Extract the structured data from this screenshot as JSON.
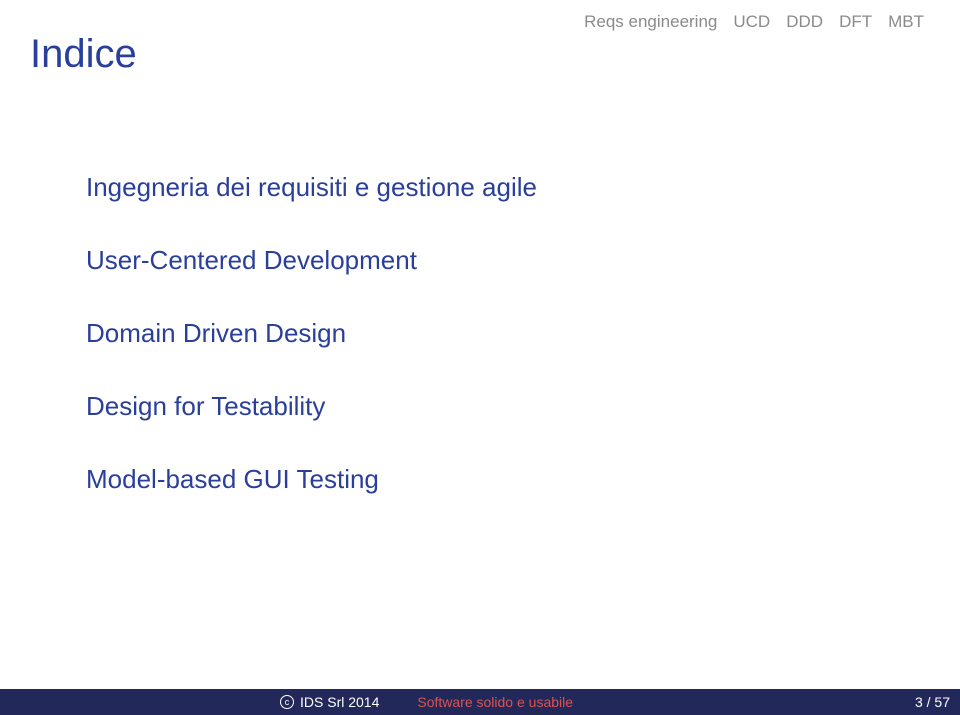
{
  "nav": {
    "items": [
      "Reqs engineering",
      "UCD",
      "DDD",
      "DFT",
      "MBT"
    ]
  },
  "title": "Indice",
  "toc": {
    "items": [
      "Ingegneria dei requisiti e gestione agile",
      "User-Centered Development",
      "Domain Driven Design",
      "Design for Testability",
      "Model-based GUI Testing"
    ]
  },
  "footer": {
    "copyright_symbol": "c",
    "org": "IDS Srl 2014",
    "title": "Software solido e usabile",
    "page": "3 / 57"
  }
}
